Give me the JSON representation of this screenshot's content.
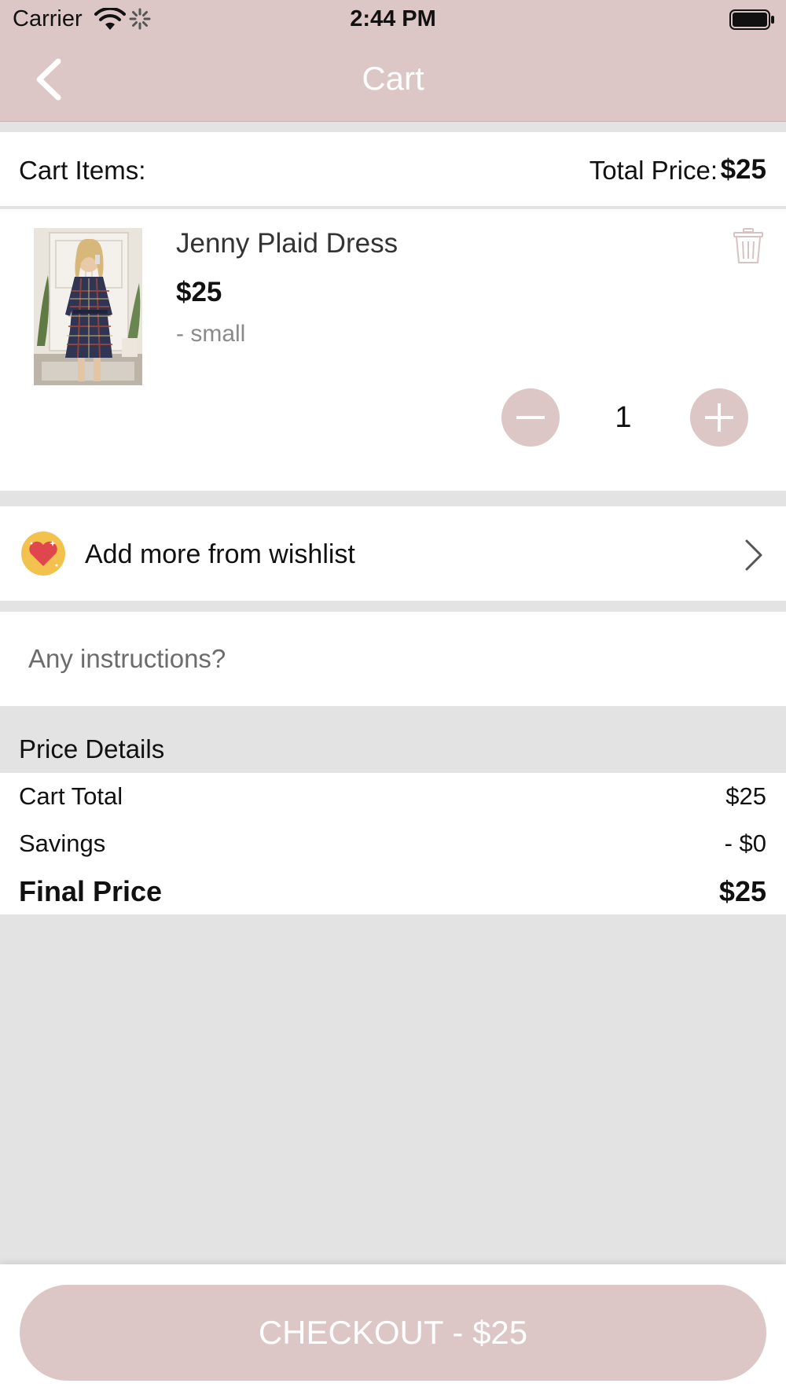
{
  "status_bar": {
    "carrier": "Carrier",
    "time": "2:44 PM"
  },
  "nav": {
    "title": "Cart",
    "back_icon": "chevron-left-icon"
  },
  "cart_header": {
    "items_label": "Cart Items:",
    "total_label": "Total Price:",
    "total_value": "$25"
  },
  "item": {
    "name": "Jenny Plaid Dress",
    "price": "$25",
    "size": "- small",
    "quantity": "1",
    "delete_icon": "trash-icon"
  },
  "wishlist": {
    "label": "Add more from wishlist",
    "icon": "heart-icon"
  },
  "instructions": {
    "placeholder": "Any instructions?"
  },
  "price_details": {
    "title": "Price Details",
    "cart_total_label": "Cart Total",
    "cart_total_value": "$25",
    "savings_label": "Savings",
    "savings_value": "- $0",
    "final_label": "Final Price",
    "final_value": "$25"
  },
  "checkout": {
    "label": "CHECKOUT - $25"
  },
  "colors": {
    "accent": "#dcc6c6",
    "background": "#e3e3e3",
    "wish_badge": "#f2c14e",
    "heart": "#e0474c"
  }
}
